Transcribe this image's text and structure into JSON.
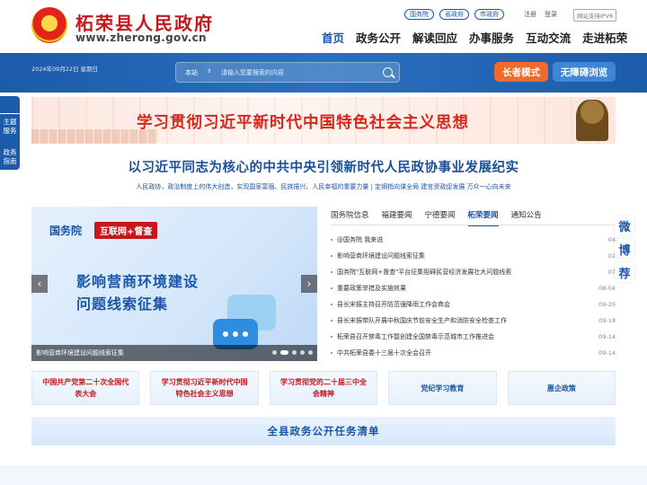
{
  "header": {
    "site_name": "柘荣县人民政府",
    "site_url": "www.zherong.gov.cn",
    "top_links": [
      "国务院",
      "省政府",
      "市政府"
    ],
    "register": "注册",
    "login": "登录",
    "ipv6": "网站支持IPV6",
    "nav": [
      "首页",
      "政务公开",
      "解读回应",
      "办事服务",
      "互动交流",
      "走进柘荣"
    ]
  },
  "band": {
    "date": "2024年09月22日 星期日",
    "search_scope": "本站",
    "search_placeholder": "请输入您要搜索的内容",
    "elder_mode": "长者模式",
    "accessible": "无障碍浏览"
  },
  "float_left": [
    "主题服务",
    "政务指南"
  ],
  "float_right": [
    "微",
    "博",
    "荐"
  ],
  "slogan": "学习贯彻习近平新时代中国特色社会主义思想",
  "headline": "以习近平同志为核心的中共中央引领新时代人民政协事业发展纪实",
  "subline": "人民政协，政治制度上的伟大创造，实现国家富强、民族振兴、人民幸福的重要力量 | 定纲指向谋全局 建言资政促发展 万众一心向未来",
  "carousel": {
    "brand": "国务院",
    "tag": "互联网+督查",
    "title_line1": "影响营商环境建设",
    "title_line2": "问题线索征集",
    "caption": "影响营商环境建设问题线索征集",
    "prev": "‹",
    "next": "›"
  },
  "news": {
    "tabs": [
      "国务院信息",
      "福建要闻",
      "宁德要闻",
      "柘荣要闻",
      "通知公告"
    ],
    "items": [
      {
        "title": "@国务院 我来说",
        "date": "04"
      },
      {
        "title": "影响营商环境建设问题线索征集",
        "date": "02"
      },
      {
        "title": "国务院\"互联网+督查\"平台征集阻碍民营经济发展壮大问题线索",
        "date": "07"
      },
      {
        "title": "重要政策举措及实施效果",
        "date": "08-04"
      },
      {
        "title": "县长宋振主持召开防范强降雨工作会商会",
        "date": "09-20"
      },
      {
        "title": "县长宋振带队开展中秋国庆节前安全生产和消防安全检查工作",
        "date": "09-18"
      },
      {
        "title": "柘荣县召开禁毒工作暨创建全国禁毒示范城市工作推进会",
        "date": "09-14"
      },
      {
        "title": "中共柘荣县委十三届十次全会召开",
        "date": "09-14"
      }
    ]
  },
  "topics": [
    "中国共产党第二十次全国代表大会",
    "学习贯彻习近平新时代中国特色社会主义思想",
    "学习贯彻党的二十届三中全会精神",
    "党纪学习教育",
    "惠企政策"
  ],
  "task_list": "全县政务公开任务清单"
}
